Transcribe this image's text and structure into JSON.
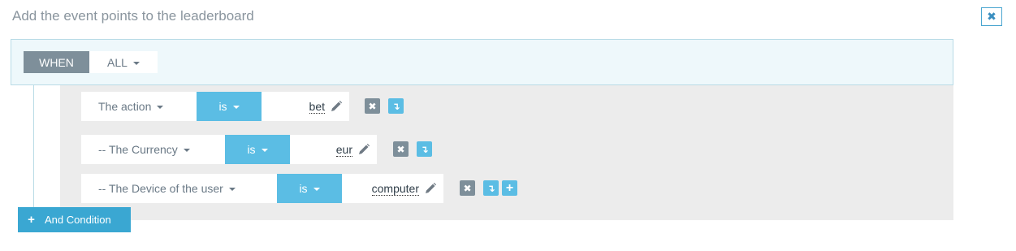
{
  "header": {
    "title": "Add the event points to the leaderboard",
    "close_glyph": "✖"
  },
  "when": {
    "label": "WHEN",
    "match_value": "ALL"
  },
  "conditions": [
    {
      "field": "The action",
      "operator": "is",
      "value": "bet"
    },
    {
      "field": "-- The Currency",
      "operator": "is",
      "value": "eur"
    },
    {
      "field": "-- The Device of the user",
      "operator": "is",
      "value": "computer"
    }
  ],
  "icons": {
    "delete": "✖",
    "nest": "↴",
    "add": "+"
  },
  "footer": {
    "add_condition_label": "And Condition",
    "add_glyph": "+"
  },
  "colors": {
    "accent": "#5bbde4",
    "button": "#3aa7d2",
    "muted": "#7e8f9a",
    "panel": "#ececec",
    "when_bg": "#eef8fb"
  }
}
